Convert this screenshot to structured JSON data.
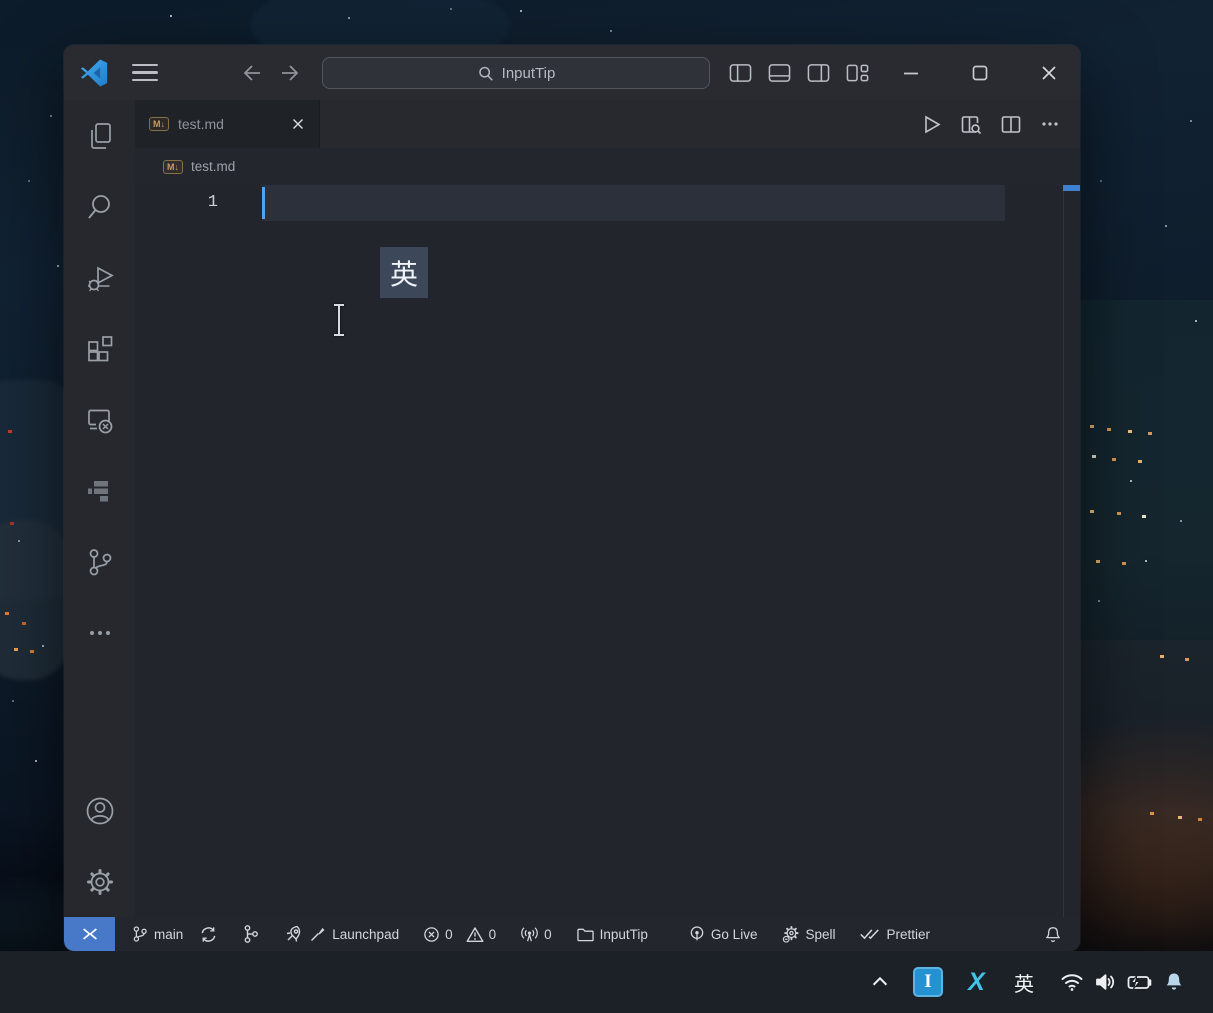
{
  "titlebar": {
    "search_value": "InputTip"
  },
  "tabs": [
    {
      "label": "test.md",
      "active": true
    }
  ],
  "breadcrumb": {
    "file": "test.md"
  },
  "file_icon_label": "M↓",
  "editor": {
    "active_line_number": "1",
    "ime_popup": "英"
  },
  "statusbar": {
    "branch": "main",
    "launchpad_label": "Launchpad",
    "errors_count": "0",
    "warnings_count": "0",
    "ports_count": "0",
    "project_label": "InputTip",
    "go_live_label": "Go Live",
    "spell_label": "Spell",
    "prettier_label": "Prettier"
  },
  "taskbar": {
    "tray_i_label": "I",
    "tray_x_label": "X",
    "tray_ime_label": "英"
  },
  "colors": {
    "accent_blue": "#4da3f5",
    "remote_badge_bg": "#4878c8",
    "md_icon": "#c89a5b",
    "ime_popup_bg": "#3c4759",
    "tray_app_blue": "#2492d0",
    "tray_app_cyan": "#3fc3e8",
    "status_overview_mark": "#3f7fd0"
  }
}
